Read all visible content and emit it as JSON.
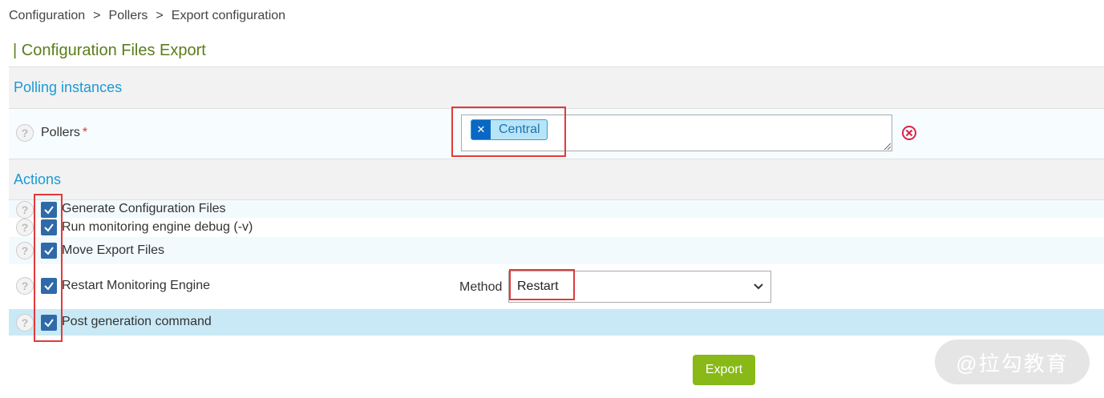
{
  "breadcrumb": {
    "items": [
      "Configuration",
      "Pollers",
      "Export configuration"
    ],
    "separator": ">"
  },
  "page_title": "| Configuration Files Export",
  "polling_section": {
    "title": "Polling instances",
    "pollers": {
      "label": "Pollers",
      "required_mark": "*",
      "selected": [
        "Central"
      ],
      "tag_remove_icon": "x-icon",
      "clear_icon": "circle-x-icon"
    }
  },
  "actions_section": {
    "title": "Actions",
    "items": [
      {
        "label": "Generate Configuration Files",
        "checked": true
      },
      {
        "label": "Run monitoring engine debug (-v)",
        "checked": true
      },
      {
        "label": "Move Export Files",
        "checked": true
      },
      {
        "label": "Restart Monitoring Engine",
        "checked": true
      },
      {
        "label": "Post generation command",
        "checked": true
      }
    ],
    "method": {
      "label": "Method",
      "value": "Restart"
    }
  },
  "export_button": "Export",
  "watermark": "@拉勾教育",
  "colors": {
    "title_green": "#5a7d1a",
    "section_blue": "#1a9ad6",
    "checkbox_blue": "#2f6aa8",
    "export_green": "#88b917",
    "highlight_red": "#e23a3a"
  }
}
